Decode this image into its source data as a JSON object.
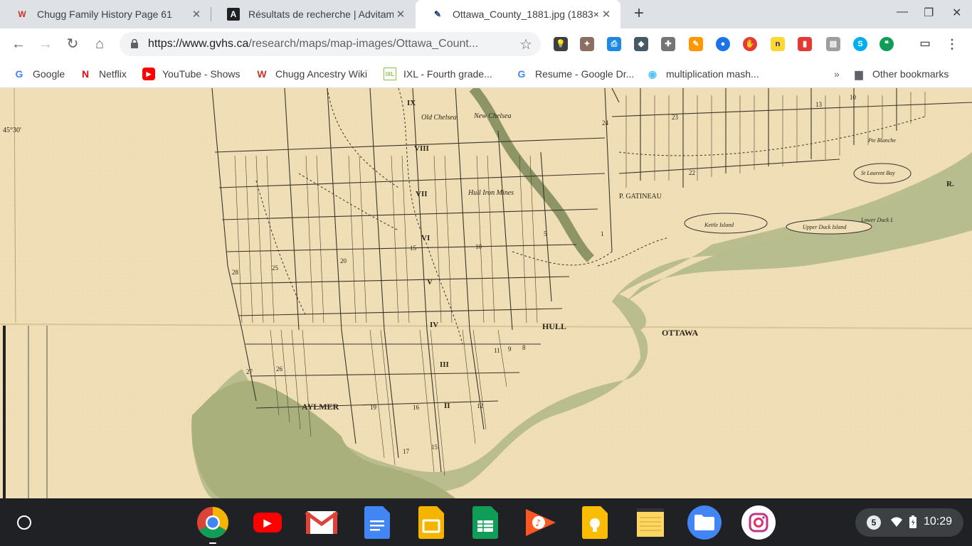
{
  "tabs": [
    {
      "title": "Chugg Family History Page 61",
      "favicon": "W",
      "favicon_color": "#c0392b",
      "active": false
    },
    {
      "title": "Résultats de recherche | Advitam",
      "favicon": "A",
      "favicon_color": "#202124",
      "active": false
    },
    {
      "title": "Ottawa_County_1881.jpg (1883×",
      "favicon": "✎",
      "favicon_color": "#1a3a6b",
      "active": true
    }
  ],
  "toolbar": {
    "url_host": "https://www.gvhs.ca",
    "url_path": "/research/maps/map-images/Ottawa_Count..."
  },
  "bookmarks": [
    {
      "label": "Google",
      "icon": "G",
      "color": "#4285f4"
    },
    {
      "label": "Netflix",
      "icon": "N",
      "color": "#e50914"
    },
    {
      "label": "YouTube - Shows",
      "icon": "▶",
      "color": "#ff0000"
    },
    {
      "label": "Chugg Ancestry Wiki",
      "icon": "W",
      "color": "#c0392b"
    },
    {
      "label": "IXL - Fourth grade...",
      "icon": "IXL",
      "color": "#8bc34a"
    },
    {
      "label": "Resume - Google Dr...",
      "icon": "G",
      "color": "#4285f4"
    },
    {
      "label": "multiplication mash...",
      "icon": "◉",
      "color": "#4fc3f7"
    }
  ],
  "bookmarks_overflow": "»",
  "other_bookmarks": "Other bookmarks",
  "map": {
    "labels": {
      "hull": "HULL",
      "aylmer": "AYLMER",
      "ottawa": "OTTAWA",
      "p_gatineau": "P. GATINEAU",
      "old_chelsea": "Old Chelsea",
      "new_chelsea": "New Chelsea",
      "hull_iron_mines": "Hull Iron Mines",
      "lat": "45°30'",
      "r": "R.",
      "kettle_island": "Kettle Island",
      "upper_duck": "Upper Duck Island",
      "lower_duck": "Lower Duck I.",
      "st_laurent": "St Laurent Bay",
      "pte_blanche": "Pte Blanche"
    },
    "ranges": [
      "IX",
      "VIII",
      "VII",
      "VI",
      "V",
      "IV",
      "III",
      "II"
    ],
    "lot_numbers": [
      "28",
      "25",
      "20",
      "15",
      "10",
      "5",
      "1",
      "24",
      "23",
      "22",
      "27",
      "26",
      "19",
      "16",
      "12",
      "11",
      "9",
      "8",
      "17",
      "15",
      "13",
      "10"
    ]
  },
  "shelf": {
    "apps": [
      {
        "name": "chrome",
        "color": "#ffffff"
      },
      {
        "name": "youtube",
        "color": "#ff0000"
      },
      {
        "name": "gmail",
        "color": "#ffffff"
      },
      {
        "name": "docs",
        "color": "#4285f4"
      },
      {
        "name": "slides",
        "color": "#f4b400"
      },
      {
        "name": "sheets",
        "color": "#0f9d58"
      },
      {
        "name": "play-music",
        "color": "#ff5722"
      },
      {
        "name": "keep",
        "color": "#fbbc04"
      },
      {
        "name": "notes",
        "color": "#fdd663"
      },
      {
        "name": "files",
        "color": "#4285f4"
      },
      {
        "name": "instagram",
        "color": "#ffffff"
      }
    ],
    "notification_count": "5",
    "time": "10:29"
  }
}
